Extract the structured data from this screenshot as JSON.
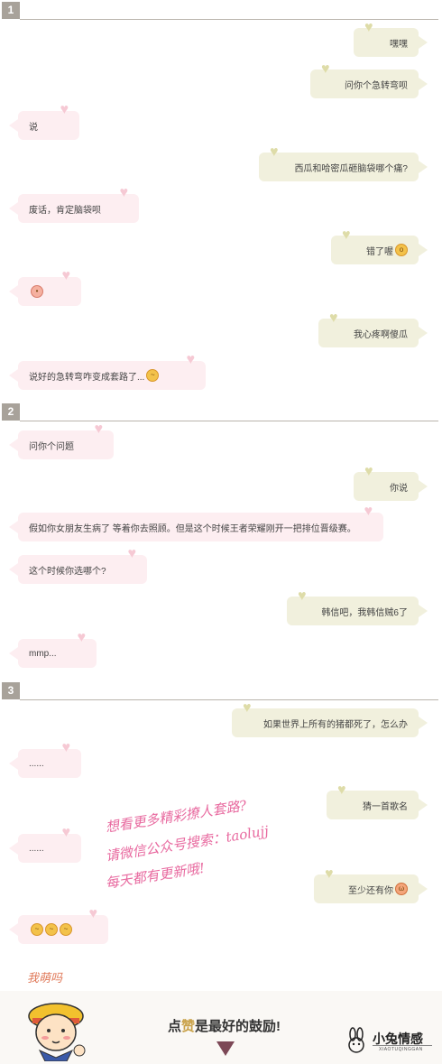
{
  "sections": [
    "1",
    "2",
    "3"
  ],
  "messages": [
    {
      "side": "right",
      "text": "嘿嘿"
    },
    {
      "side": "right",
      "text": "问你个急转弯呗"
    },
    {
      "side": "left",
      "text": "说"
    },
    {
      "side": "right",
      "text": "西瓜和哈密瓜砸脑袋哪个痛?"
    },
    {
      "side": "left",
      "text": "废话，肯定脑袋呗"
    },
    {
      "side": "right",
      "text": "错了喔"
    },
    {
      "side": "left",
      "text": ""
    },
    {
      "side": "right",
      "text": "我心疼啊傻瓜"
    },
    {
      "side": "left",
      "text": "说好的急转弯咋变成套路了..."
    },
    {
      "side": "left",
      "text": "问你个问题"
    },
    {
      "side": "right",
      "text": "你说"
    },
    {
      "side": "left",
      "text": "假如你女朋友生病了 等着你去照顾。但是这个时候王者荣耀刚开一把排位晋级赛。"
    },
    {
      "side": "left",
      "text": "这个时候你选哪个?"
    },
    {
      "side": "right",
      "text": "韩信吧，我韩信贼6了"
    },
    {
      "side": "left",
      "text": "mmp..."
    },
    {
      "side": "right",
      "text": "如果世界上所有的猪都死了，怎么办"
    },
    {
      "side": "left",
      "text": "......"
    },
    {
      "side": "right",
      "text": "猜一首歌名"
    },
    {
      "side": "left",
      "text": "......"
    },
    {
      "side": "right",
      "text": "至少还有你"
    },
    {
      "side": "left",
      "text": ""
    }
  ],
  "overlay": {
    "line1": "想看更多精彩撩人套路?",
    "line2": "请微信公众号搜索：taolujj",
    "line3": "每天都有更新哦!"
  },
  "footer": {
    "sticker_caption": "我萌吗",
    "praise_prefix": "点",
    "praise_highlight": "赞",
    "praise_suffix": "是最好的鼓励!",
    "logo_text": "小兔情感",
    "logo_sub": "XIAOTUQINGGAN"
  },
  "colors": {
    "right_bubble": "#f1f0dd",
    "left_bubble": "#fdeef1",
    "overlay_text": "#e8699f",
    "section_tag": "#a8a29a"
  }
}
